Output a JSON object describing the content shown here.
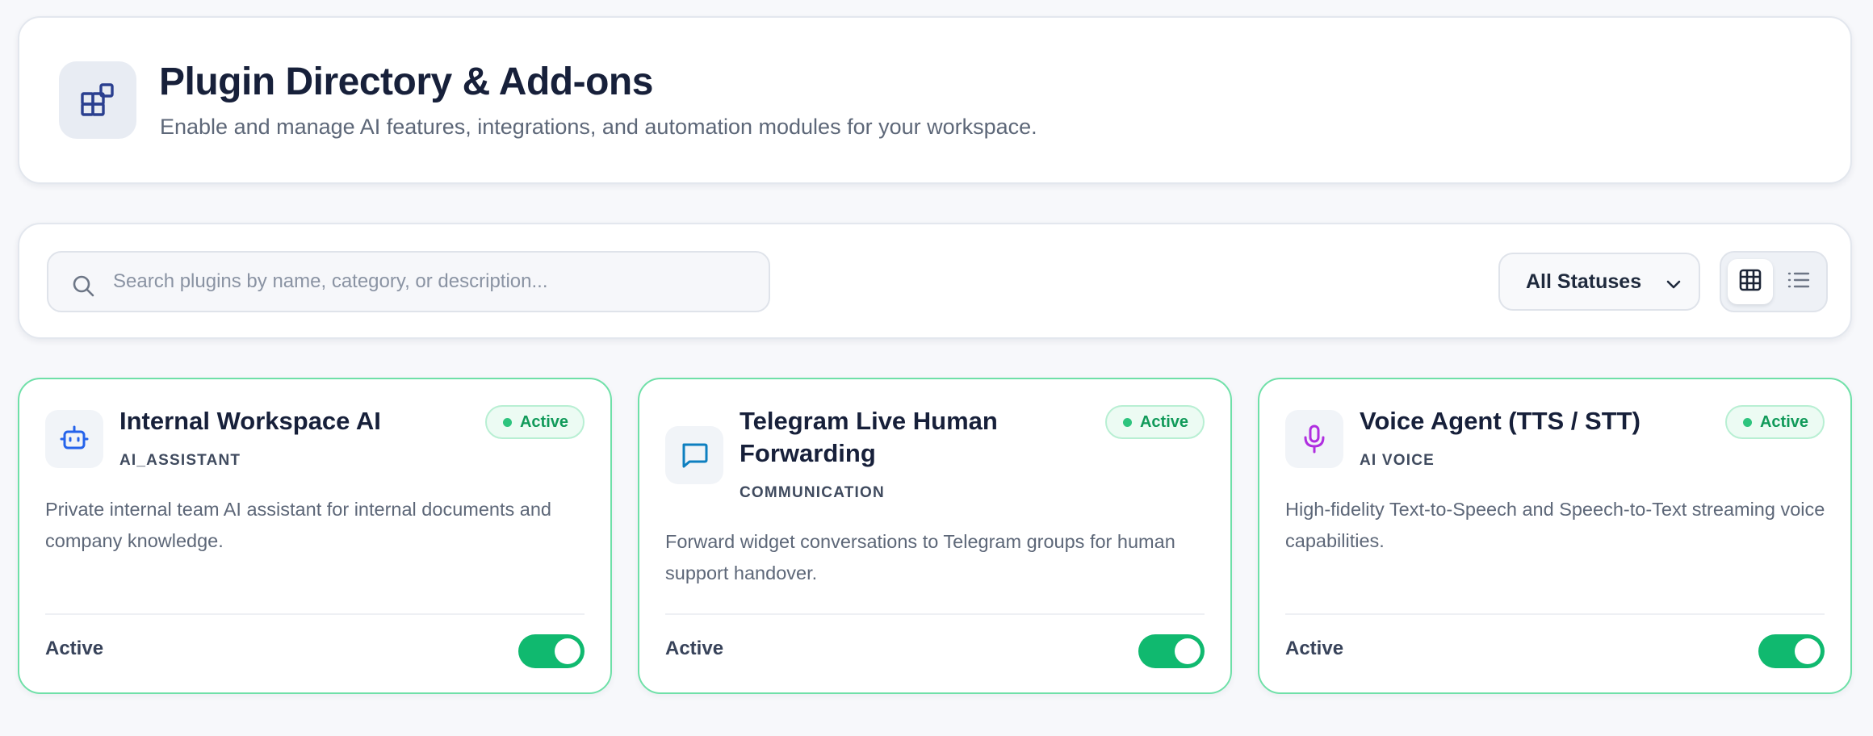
{
  "header": {
    "title": "Plugin Directory & Add-ons",
    "subtitle": "Enable and manage AI features, integrations, and automation modules for your workspace.",
    "icon": "plugins-grid-icon"
  },
  "toolbar": {
    "search_placeholder": "Search plugins by name, category, or description...",
    "search_value": "",
    "status_filter": "All Statuses",
    "view_mode": "grid"
  },
  "plugins": [
    {
      "name": "Internal Workspace AI",
      "category": "AI_ASSISTANT",
      "badge": "Active",
      "description": "Private internal team AI assistant for internal documents and company knowledge.",
      "footer_label": "Active",
      "enabled": true,
      "icon": "bot-icon",
      "icon_color": "#2563eb"
    },
    {
      "name": "Telegram Live Human Forwarding",
      "category": "COMMUNICATION",
      "badge": "Active",
      "description": "Forward widget conversations to Telegram groups for human support handover.",
      "footer_label": "Active",
      "enabled": true,
      "icon": "chat-bubble-icon",
      "icon_color": "#0e7fc0"
    },
    {
      "name": "Voice Agent (TTS / STT)",
      "category": "AI VOICE",
      "badge": "Active",
      "description": "High-fidelity Text-to-Speech and Speech-to-Text streaming voice capabilities.",
      "footer_label": "Active",
      "enabled": true,
      "icon": "microphone-icon",
      "icon_color": "#b02ee0"
    }
  ],
  "colors": {
    "active_green": "#10b96f",
    "card_border": "#6fe0a8",
    "header_icon": "#2a3f8f"
  }
}
